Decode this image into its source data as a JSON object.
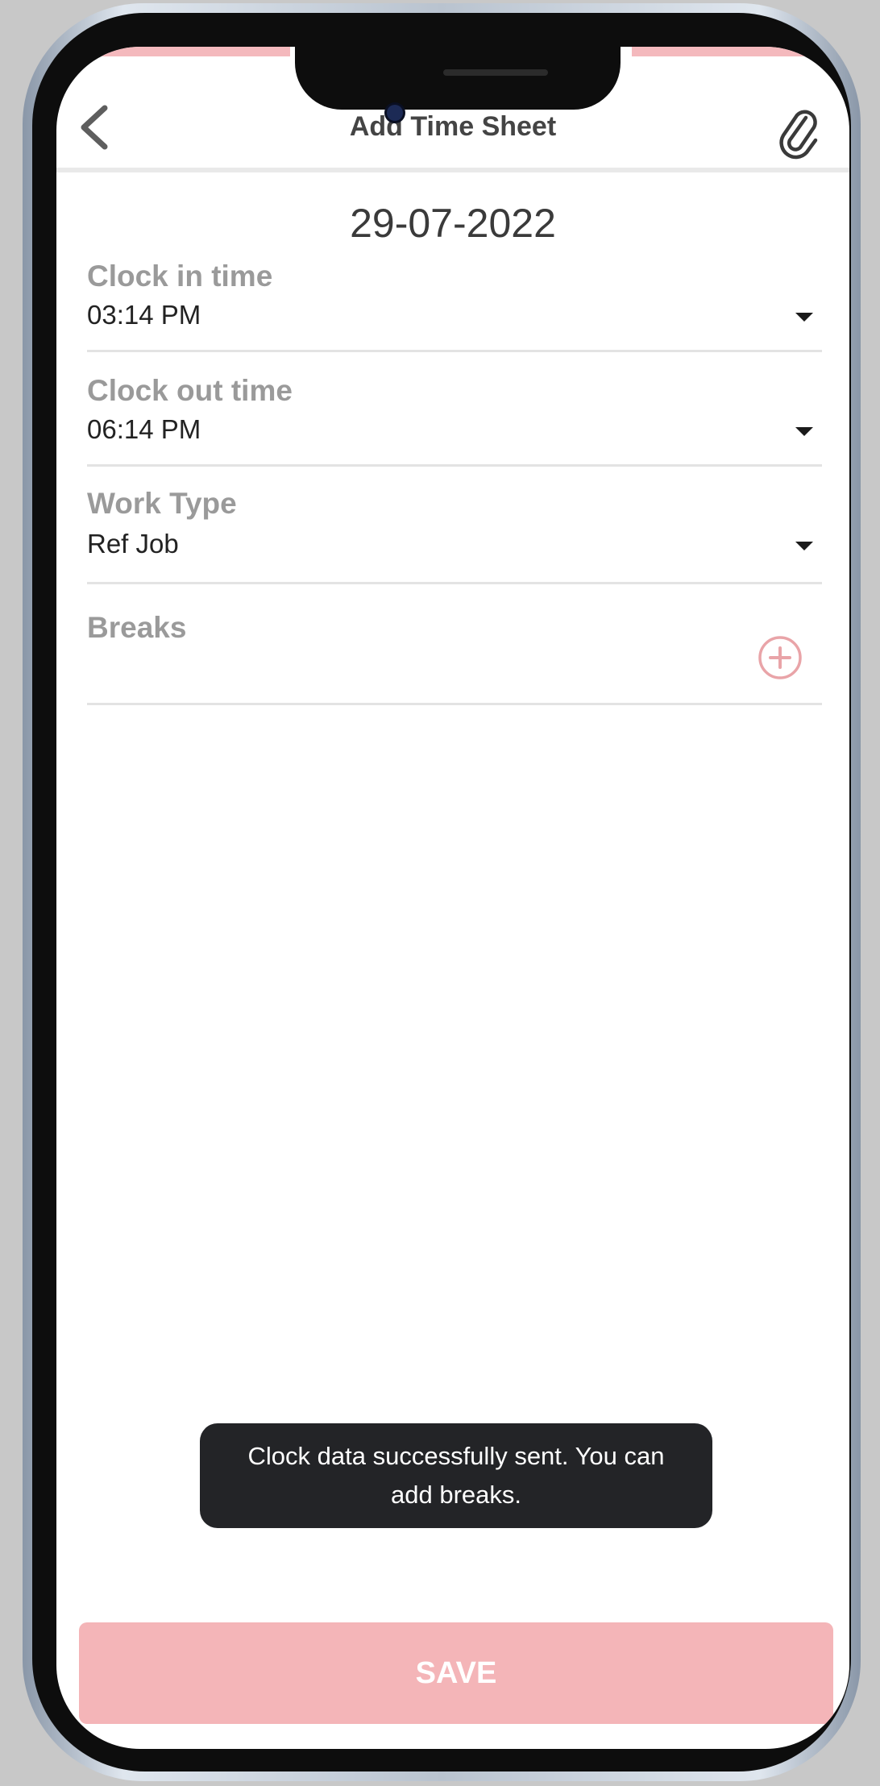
{
  "header": {
    "title": "Add Time Sheet",
    "back_icon": "chevron-left-icon",
    "attach_icon": "paperclip-icon"
  },
  "date": "29-07-2022",
  "fields": {
    "clock_in": {
      "label": "Clock in time",
      "value": "03:14 PM"
    },
    "clock_out": {
      "label": "Clock out time",
      "value": "06:14 PM"
    },
    "work_type": {
      "label": "Work Type",
      "value": "Ref Job"
    },
    "breaks": {
      "label": "Breaks",
      "add_icon": "plus-circle-icon"
    }
  },
  "toast": {
    "message": "Clock data successfully sent. You can add breaks."
  },
  "save_label": "SAVE",
  "colors": {
    "accent": "#f4b5b8",
    "accent_outline": "#e9a4a8",
    "toast_bg": "#232427",
    "label_gray": "#9a9a9a"
  }
}
